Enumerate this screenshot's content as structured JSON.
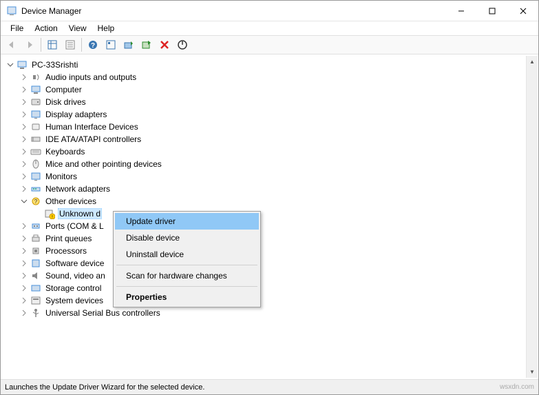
{
  "window": {
    "title": "Device Manager"
  },
  "menu": {
    "file": "File",
    "action": "Action",
    "view": "View",
    "help": "Help"
  },
  "tree": {
    "root": "PC-33Srishti",
    "items": [
      {
        "label": "Audio inputs and outputs",
        "icon": "audio"
      },
      {
        "label": "Computer",
        "icon": "computer"
      },
      {
        "label": "Disk drives",
        "icon": "disk"
      },
      {
        "label": "Display adapters",
        "icon": "display"
      },
      {
        "label": "Human Interface Devices",
        "icon": "hid"
      },
      {
        "label": "IDE ATA/ATAPI controllers",
        "icon": "ide"
      },
      {
        "label": "Keyboards",
        "icon": "keyboard"
      },
      {
        "label": "Mice and other pointing devices",
        "icon": "mouse"
      },
      {
        "label": "Monitors",
        "icon": "monitor"
      },
      {
        "label": "Network adapters",
        "icon": "network"
      }
    ],
    "other_devices": {
      "label": "Other devices",
      "child": "Unknown d"
    },
    "items2": [
      {
        "label": "Ports (COM & L",
        "icon": "ports"
      },
      {
        "label": "Print queues",
        "icon": "print"
      },
      {
        "label": "Processors",
        "icon": "cpu"
      },
      {
        "label": "Software device",
        "icon": "soft"
      },
      {
        "label": "Sound, video an",
        "icon": "sound"
      },
      {
        "label": "Storage control",
        "icon": "storage"
      },
      {
        "label": "System devices",
        "icon": "system"
      },
      {
        "label": "Universal Serial Bus controllers",
        "icon": "usb"
      }
    ]
  },
  "context_menu": {
    "update": "Update driver",
    "disable": "Disable device",
    "uninstall": "Uninstall device",
    "scan": "Scan for hardware changes",
    "properties": "Properties"
  },
  "statusbar": {
    "text": "Launches the Update Driver Wizard for the selected device.",
    "watermark": "wsxdn.com"
  }
}
